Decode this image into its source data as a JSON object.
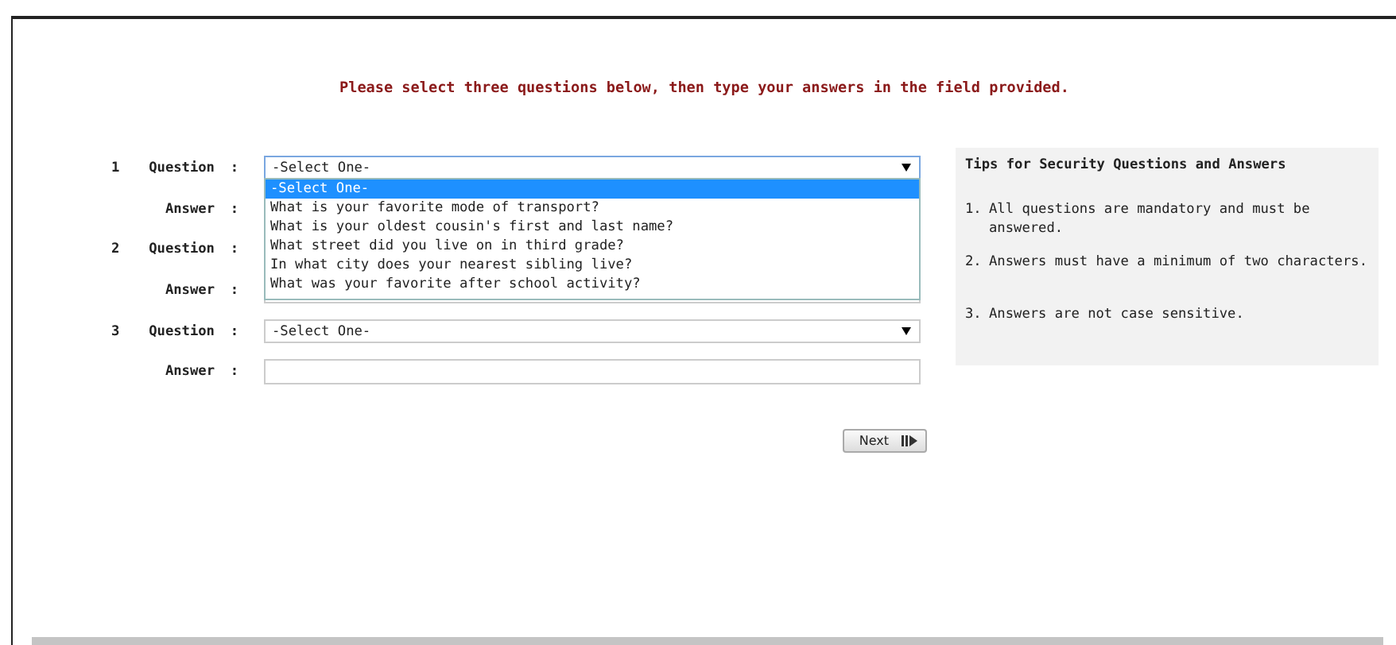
{
  "instruction": "Please select three questions below, then type your answers in the field provided.",
  "questions": [
    {
      "number": "1",
      "question_label": "Question",
      "question_colon": ":",
      "value": "-Select One-",
      "answer_label": "Answer",
      "answer_colon": ":",
      "dropdown": {
        "options": [
          {
            "label": "-Select One-",
            "selected": true
          },
          {
            "label": "What is your favorite mode of transport?",
            "selected": false
          },
          {
            "label": "What is your oldest cousin's first and last name?",
            "selected": false
          },
          {
            "label": "What street did you live on in third grade?",
            "selected": false
          },
          {
            "label": "In what city does your nearest sibling live?",
            "selected": false
          },
          {
            "label": "What was your favorite after school activity?",
            "selected": false
          }
        ]
      }
    },
    {
      "number": "2",
      "question_label": "Question",
      "question_colon": ":",
      "answer_label": "Answer",
      "answer_colon": ":"
    },
    {
      "number": "3",
      "question_label": "Question",
      "question_colon": ":",
      "value": "-Select One-",
      "answer_label": "Answer",
      "answer_colon": ":"
    }
  ],
  "tips": {
    "title": "Tips for Security Questions and Answers",
    "items": [
      {
        "number": "1.",
        "text": "All questions are mandatory and must be answered."
      },
      {
        "number": "2.",
        "text": "Answers must have a minimum of two characters."
      },
      {
        "number": "3.",
        "text": "Answers are not case sensitive."
      }
    ]
  },
  "next_button": {
    "label": "Next"
  }
}
